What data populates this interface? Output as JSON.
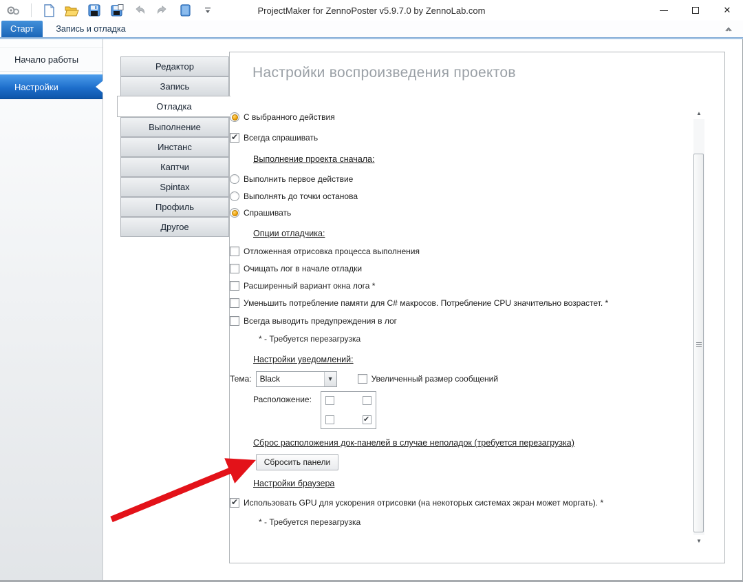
{
  "window": {
    "title": "ProjectMaker for ZennoPoster v5.9.7.0 by ZennoLab.com",
    "controls": [
      "minimize",
      "maximize",
      "close"
    ]
  },
  "toolbar": {
    "icons": [
      "app-logo",
      "new-project",
      "open-project",
      "save",
      "save-as",
      "undo",
      "redo",
      "browser-panel",
      "toolbar-overflow"
    ]
  },
  "ribbon_tabs": [
    {
      "label": "Старт",
      "active": true
    },
    {
      "label": "Запись и отладка",
      "active": false
    }
  ],
  "ribbon": {
    "collapse_icon": "collapse-ribbon"
  },
  "sidebar": {
    "items": [
      {
        "label": "Начало работы",
        "active": false
      },
      {
        "label": "Настройки",
        "active": true
      }
    ]
  },
  "settings_tabs": {
    "items": [
      {
        "label": "Редактор",
        "active": false
      },
      {
        "label": "Запись",
        "active": false
      },
      {
        "label": "Отладка",
        "active": true
      },
      {
        "label": "Выполнение",
        "active": false
      },
      {
        "label": "Инстанс",
        "active": false
      },
      {
        "label": "Каптчи",
        "active": false
      },
      {
        "label": "Spintax",
        "active": false
      },
      {
        "label": "Профиль",
        "active": false
      },
      {
        "label": "Другое",
        "active": false
      }
    ]
  },
  "panel": {
    "title": "Настройки воспроизведения проектов",
    "start_radio": {
      "label": "С выбранного действия",
      "checked": true
    },
    "always_ask": {
      "label": "Всегда спрашивать",
      "checked": true
    },
    "run_first": {
      "title": "Выполнение проекта сначала:",
      "options": [
        {
          "label": "Выполнить первое действие",
          "checked": false
        },
        {
          "label": "Выполнять до точки останова",
          "checked": false
        },
        {
          "label": "Спрашивать",
          "checked": true
        }
      ]
    },
    "debug_options": {
      "title": "Опции отладчика:",
      "options": [
        {
          "label": "Отложенная отрисовка процесса выполнения",
          "checked": false
        },
        {
          "label": "Очищать лог в начале отладки",
          "checked": false
        },
        {
          "label": "Расширенный вариант окна лога *",
          "checked": false
        },
        {
          "label": "Уменьшить потребление памяти для C# макросов. Потребление CPU значительно возрастет. *",
          "checked": false
        },
        {
          "label": "Всегда выводить предупреждения в лог",
          "checked": false
        }
      ],
      "note": "* - Требуется перезагрузка"
    },
    "notifications": {
      "title": "Настройки уведомлений:",
      "theme_label": "Тема:",
      "theme_value": "Black",
      "bigger_messages": {
        "label": "Увеличенный размер сообщений",
        "checked": false
      },
      "position_label": "Расположение:",
      "position_checkboxes": [
        {
          "name": "top-left",
          "checked": false
        },
        {
          "name": "top-right",
          "checked": false
        },
        {
          "name": "bottom-left",
          "checked": false
        },
        {
          "name": "bottom-right",
          "checked": true
        }
      ]
    },
    "dock_reset": {
      "title": "Сброс расположения док-панелей в случае неполадок (требуется перезагрузка)",
      "button_label": "Сбросить панели"
    },
    "browser": {
      "title": "Настройки браузера",
      "gpu": {
        "label": "Использовать GPU для ускорения отрисовки (на некоторых системах экран может моргать). *",
        "checked": true
      },
      "note": "* - Требуется перезагрузка"
    }
  },
  "colors": {
    "accent_blue": "#1d6ecb",
    "radio_selected": "#f0a30a",
    "annotation_arrow": "#e31219"
  }
}
